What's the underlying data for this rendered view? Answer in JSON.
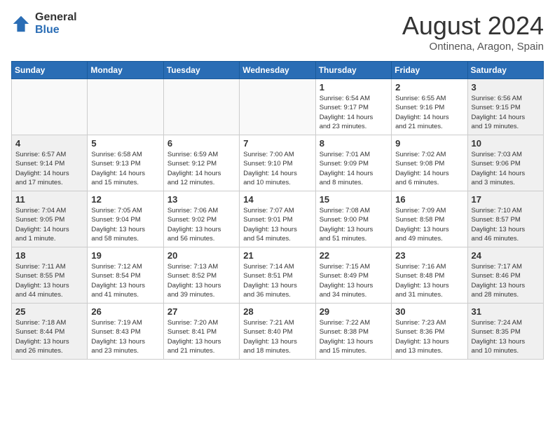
{
  "logo": {
    "general": "General",
    "blue": "Blue"
  },
  "title": {
    "month_year": "August 2024",
    "location": "Ontinena, Aragon, Spain"
  },
  "days_of_week": [
    "Sunday",
    "Monday",
    "Tuesday",
    "Wednesday",
    "Thursday",
    "Friday",
    "Saturday"
  ],
  "weeks": [
    [
      {
        "day": "",
        "info": ""
      },
      {
        "day": "",
        "info": ""
      },
      {
        "day": "",
        "info": ""
      },
      {
        "day": "",
        "info": ""
      },
      {
        "day": "1",
        "info": "Sunrise: 6:54 AM\nSunset: 9:17 PM\nDaylight: 14 hours\nand 23 minutes."
      },
      {
        "day": "2",
        "info": "Sunrise: 6:55 AM\nSunset: 9:16 PM\nDaylight: 14 hours\nand 21 minutes."
      },
      {
        "day": "3",
        "info": "Sunrise: 6:56 AM\nSunset: 9:15 PM\nDaylight: 14 hours\nand 19 minutes."
      }
    ],
    [
      {
        "day": "4",
        "info": "Sunrise: 6:57 AM\nSunset: 9:14 PM\nDaylight: 14 hours\nand 17 minutes."
      },
      {
        "day": "5",
        "info": "Sunrise: 6:58 AM\nSunset: 9:13 PM\nDaylight: 14 hours\nand 15 minutes."
      },
      {
        "day": "6",
        "info": "Sunrise: 6:59 AM\nSunset: 9:12 PM\nDaylight: 14 hours\nand 12 minutes."
      },
      {
        "day": "7",
        "info": "Sunrise: 7:00 AM\nSunset: 9:10 PM\nDaylight: 14 hours\nand 10 minutes."
      },
      {
        "day": "8",
        "info": "Sunrise: 7:01 AM\nSunset: 9:09 PM\nDaylight: 14 hours\nand 8 minutes."
      },
      {
        "day": "9",
        "info": "Sunrise: 7:02 AM\nSunset: 9:08 PM\nDaylight: 14 hours\nand 6 minutes."
      },
      {
        "day": "10",
        "info": "Sunrise: 7:03 AM\nSunset: 9:06 PM\nDaylight: 14 hours\nand 3 minutes."
      }
    ],
    [
      {
        "day": "11",
        "info": "Sunrise: 7:04 AM\nSunset: 9:05 PM\nDaylight: 14 hours\nand 1 minute."
      },
      {
        "day": "12",
        "info": "Sunrise: 7:05 AM\nSunset: 9:04 PM\nDaylight: 13 hours\nand 58 minutes."
      },
      {
        "day": "13",
        "info": "Sunrise: 7:06 AM\nSunset: 9:02 PM\nDaylight: 13 hours\nand 56 minutes."
      },
      {
        "day": "14",
        "info": "Sunrise: 7:07 AM\nSunset: 9:01 PM\nDaylight: 13 hours\nand 54 minutes."
      },
      {
        "day": "15",
        "info": "Sunrise: 7:08 AM\nSunset: 9:00 PM\nDaylight: 13 hours\nand 51 minutes."
      },
      {
        "day": "16",
        "info": "Sunrise: 7:09 AM\nSunset: 8:58 PM\nDaylight: 13 hours\nand 49 minutes."
      },
      {
        "day": "17",
        "info": "Sunrise: 7:10 AM\nSunset: 8:57 PM\nDaylight: 13 hours\nand 46 minutes."
      }
    ],
    [
      {
        "day": "18",
        "info": "Sunrise: 7:11 AM\nSunset: 8:55 PM\nDaylight: 13 hours\nand 44 minutes."
      },
      {
        "day": "19",
        "info": "Sunrise: 7:12 AM\nSunset: 8:54 PM\nDaylight: 13 hours\nand 41 minutes."
      },
      {
        "day": "20",
        "info": "Sunrise: 7:13 AM\nSunset: 8:52 PM\nDaylight: 13 hours\nand 39 minutes."
      },
      {
        "day": "21",
        "info": "Sunrise: 7:14 AM\nSunset: 8:51 PM\nDaylight: 13 hours\nand 36 minutes."
      },
      {
        "day": "22",
        "info": "Sunrise: 7:15 AM\nSunset: 8:49 PM\nDaylight: 13 hours\nand 34 minutes."
      },
      {
        "day": "23",
        "info": "Sunrise: 7:16 AM\nSunset: 8:48 PM\nDaylight: 13 hours\nand 31 minutes."
      },
      {
        "day": "24",
        "info": "Sunrise: 7:17 AM\nSunset: 8:46 PM\nDaylight: 13 hours\nand 28 minutes."
      }
    ],
    [
      {
        "day": "25",
        "info": "Sunrise: 7:18 AM\nSunset: 8:44 PM\nDaylight: 13 hours\nand 26 minutes."
      },
      {
        "day": "26",
        "info": "Sunrise: 7:19 AM\nSunset: 8:43 PM\nDaylight: 13 hours\nand 23 minutes."
      },
      {
        "day": "27",
        "info": "Sunrise: 7:20 AM\nSunset: 8:41 PM\nDaylight: 13 hours\nand 21 minutes."
      },
      {
        "day": "28",
        "info": "Sunrise: 7:21 AM\nSunset: 8:40 PM\nDaylight: 13 hours\nand 18 minutes."
      },
      {
        "day": "29",
        "info": "Sunrise: 7:22 AM\nSunset: 8:38 PM\nDaylight: 13 hours\nand 15 minutes."
      },
      {
        "day": "30",
        "info": "Sunrise: 7:23 AM\nSunset: 8:36 PM\nDaylight: 13 hours\nand 13 minutes."
      },
      {
        "day": "31",
        "info": "Sunrise: 7:24 AM\nSunset: 8:35 PM\nDaylight: 13 hours\nand 10 minutes."
      }
    ]
  ]
}
